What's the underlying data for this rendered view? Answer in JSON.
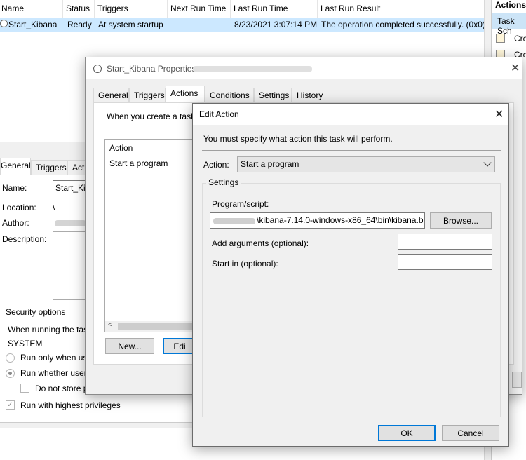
{
  "task_table": {
    "headers": [
      "Name",
      "Status",
      "Triggers",
      "Next Run Time",
      "Last Run Time",
      "Last Run Result"
    ],
    "row": {
      "name": "Start_Kibana",
      "status": "Ready",
      "triggers": "At system startup",
      "next_run": "",
      "last_run": "8/23/2021 3:07:14 PM",
      "last_result": "The operation completed successfully. (0x0)"
    }
  },
  "actions_pane": {
    "title": "Actions",
    "section": "Task Sch",
    "items": [
      "Cre",
      "Cre"
    ]
  },
  "details": {
    "tabs": [
      "General",
      "Triggers",
      "Acti"
    ],
    "name_label": "Name:",
    "name_value": "Start_Kib",
    "location_label": "Location:",
    "location_value": "\\",
    "author_label": "Author:",
    "description_label": "Description:",
    "security_label": "Security options",
    "when_running": "When running the tas",
    "account": "SYSTEM",
    "run_only": "Run only when us",
    "run_whether": "Run whether user",
    "do_not_store": "Do not store p",
    "highest": "Run with highest privileges"
  },
  "properties": {
    "title": "Start_Kibana Properties",
    "tabs": [
      "General",
      "Triggers",
      "Actions",
      "Conditions",
      "Settings",
      "History"
    ],
    "intro": "When you create a task,",
    "list_header": "Action",
    "list_row": "Start a program",
    "new_button": "New...",
    "edit_button": "Edi"
  },
  "edit_action": {
    "title": "Edit Action",
    "instruction": "You must specify what action this task will perform.",
    "action_label": "Action:",
    "action_value": "Start a program",
    "settings_label": "Settings",
    "program_label": "Program/script:",
    "program_value": "\\kibana-7.14.0-windows-x86_64\\bin\\kibana.b",
    "browse": "Browse...",
    "args_label": "Add arguments (optional):",
    "start_label": "Start in (optional):",
    "ok": "OK",
    "cancel": "Cancel"
  }
}
